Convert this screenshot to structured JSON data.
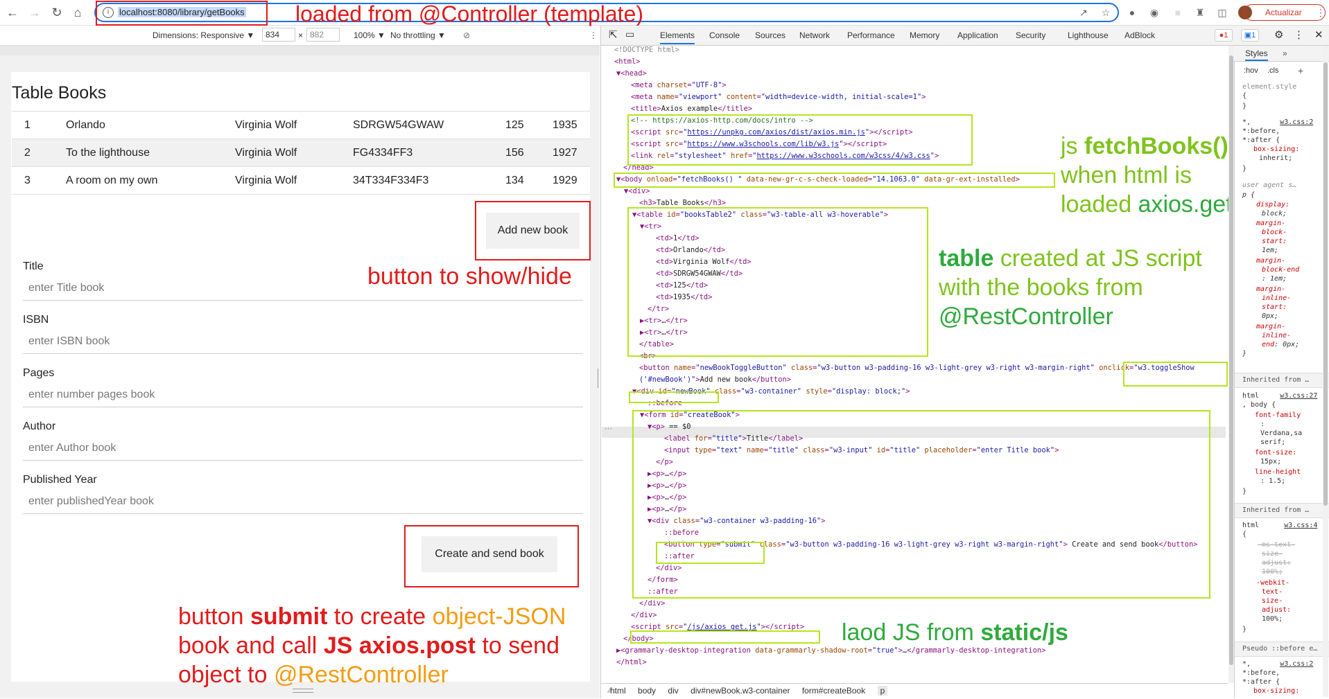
{
  "browser": {
    "url": "localhost:8080/library/getBooks",
    "update_label": "Actualizar"
  },
  "device_toolbar": {
    "dimensions_label": "Dimensions: Responsive ▼",
    "width": "834",
    "times": "×",
    "height": "882",
    "zoom": "100% ▼",
    "throttling": "No throttling ▼"
  },
  "page": {
    "heading": "Table Books",
    "books": [
      {
        "id": "1",
        "title": "Orlando",
        "author": "Virginia Wolf",
        "isbn": "SDRGW54GWAW",
        "pages": "125",
        "year": "1935"
      },
      {
        "id": "2",
        "title": "To the lighthouse",
        "author": "Virginia Wolf",
        "isbn": "FG4334FF3",
        "pages": "156",
        "year": "1927"
      },
      {
        "id": "3",
        "title": "A room on my own",
        "author": "Virginia Wolf",
        "isbn": "34T334F334F3",
        "pages": "134",
        "year": "1929"
      }
    ],
    "add_button": "Add new book",
    "form": {
      "title_label": "Title",
      "title_placeholder": "enter Title book",
      "isbn_label": "ISBN",
      "isbn_placeholder": "enter ISBN book",
      "pages_label": "Pages",
      "pages_placeholder": "enter number pages book",
      "author_label": "Author",
      "author_placeholder": "enter Author book",
      "year_label": "Published Year",
      "year_placeholder": "enter publishedYear book",
      "submit_button": "Create and send book"
    }
  },
  "annotations": {
    "controller": "loaded from @Controller (template)",
    "showhide": "button to show/hide",
    "submit_1a": "button ",
    "submit_1b": "submit",
    "submit_1c": " to create ",
    "submit_1d": "object-JSON",
    "submit_2a": "book and call ",
    "submit_2b": "JS axios.post",
    "submit_2c": " to send",
    "submit_3a": "object to ",
    "submit_3b": "@RestController",
    "fetch_1a": "js ",
    "fetch_1b": "fetchBooks()",
    "fetch_2": "when html is",
    "fetch_3a": "loaded ",
    "fetch_3b": "axios.get",
    "table_1a": "table",
    "table_1b": " created at JS script",
    "table_2": "with the books from",
    "table_3": "@RestController",
    "static_a": "laod JS from ",
    "static_b": "static/js"
  },
  "devtools": {
    "tabs": [
      "Elements",
      "Console",
      "Sources",
      "Network",
      "Performance",
      "Memory",
      "Application",
      "Security",
      "Lighthouse",
      "AdBlock"
    ],
    "error_count": "1",
    "message_count": "1",
    "styles_tab": "Styles",
    "styles_more": "»",
    "filter_hov": ":hov",
    "filter_cls": ".cls",
    "breadcrumb": [
      "html",
      "body",
      "div",
      "div#newBook.w3-container",
      "form#createBook",
      "p"
    ]
  }
}
